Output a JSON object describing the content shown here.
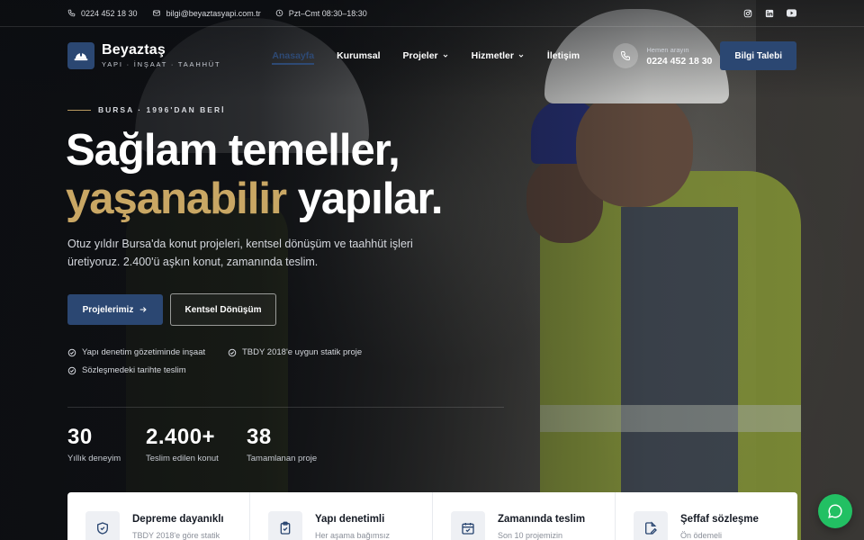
{
  "topbar": {
    "phone": "0224 452 18 30",
    "email": "bilgi@beyaztasyapi.com.tr",
    "hours": "Pzt–Cmt 08:30–18:30",
    "social_icons": [
      "instagram-icon",
      "linkedin-icon",
      "youtube-icon"
    ]
  },
  "brand": {
    "name": "Beyaztaş",
    "tagline": "YAPI · İNŞAAT · TAAHHÜT"
  },
  "nav": {
    "items": [
      {
        "label": "Anasayfa",
        "active": true,
        "dropdown": false
      },
      {
        "label": "Kurumsal",
        "active": false,
        "dropdown": false
      },
      {
        "label": "Projeler",
        "active": false,
        "dropdown": true
      },
      {
        "label": "Hizmetler",
        "active": false,
        "dropdown": true
      },
      {
        "label": "İletişim",
        "active": false,
        "dropdown": false
      }
    ]
  },
  "call": {
    "label": "Hemen arayın",
    "number": "0224 452 18 30"
  },
  "quote_button": "Bilgi Talebi",
  "hero": {
    "eyebrow": "BURSA · 1996'DAN BERİ",
    "headline_line1": "Sağlam temeller,",
    "headline_gold": "yaşanabilir",
    "headline_rest": " yapılar.",
    "lead": "Otuz yıldır Bursa'da konut projeleri, kentsel dönüşüm ve taahhüt işleri üretiyoruz. 2.400'ü aşkın konut, zamanında teslim.",
    "primary_button": "Projelerimiz",
    "secondary_button": "Kentsel Dönüşüm",
    "checks": [
      "Yapı denetim gözetiminde inşaat",
      "TBDY 2018'e uygun statik proje",
      "Sözleşmedeki tarihte teslim"
    ]
  },
  "stats": [
    {
      "value": "30",
      "label": "Yıllık deneyim"
    },
    {
      "value": "2.400+",
      "label": "Teslim edilen konut"
    },
    {
      "value": "38",
      "label": "Tamamlanan proje"
    }
  ],
  "features": [
    {
      "title": "Depreme dayanıklı",
      "text": "TBDY 2018'e göre statik",
      "icon": "shield-icon"
    },
    {
      "title": "Yapı denetimli",
      "text": "Her aşama bağımsız",
      "icon": "clipboard-check-icon"
    },
    {
      "title": "Zamanında teslim",
      "text": "Son 10 projemizin",
      "icon": "calendar-check-icon"
    },
    {
      "title": "Şeffaf sözleşme",
      "text": "Ön ödemeli",
      "icon": "document-edit-icon"
    }
  ],
  "colors": {
    "brand_blue": "#2b4772",
    "gold": "#c9a764",
    "whatsapp_green": "#22c063"
  }
}
